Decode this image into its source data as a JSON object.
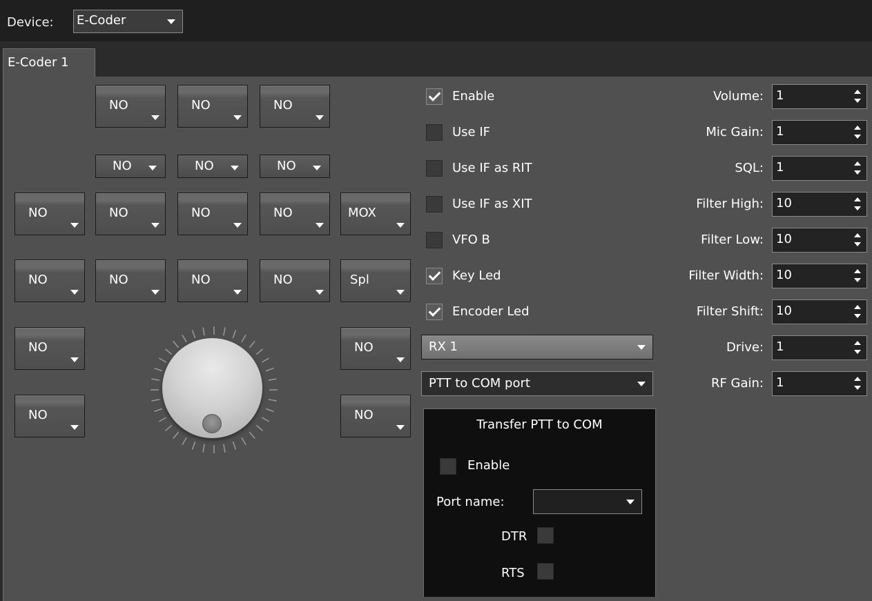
{
  "toolbar": {
    "device_label": "Device:",
    "device_value": "E-Coder"
  },
  "tabs": [
    {
      "label": "E-Coder 1"
    }
  ],
  "buttons": {
    "top_row": [
      "NO",
      "NO",
      "NO"
    ],
    "small_row": [
      "NO",
      "NO",
      "NO"
    ],
    "row1": [
      "NO",
      "NO",
      "NO",
      "NO",
      "MOX"
    ],
    "row2": [
      "NO",
      "NO",
      "NO",
      "NO",
      "Spl"
    ],
    "left_lower": [
      "NO",
      "NO"
    ],
    "right_lower": [
      "NO",
      "NO"
    ]
  },
  "checkboxes": [
    {
      "label": "Enable",
      "checked": true
    },
    {
      "label": "Use IF",
      "checked": false
    },
    {
      "label": "Use IF as RIT",
      "checked": false
    },
    {
      "label": "Use IF as XIT",
      "checked": false
    },
    {
      "label": "VFO B",
      "checked": false
    },
    {
      "label": "Key Led",
      "checked": true
    },
    {
      "label": "Encoder Led",
      "checked": true
    }
  ],
  "rx_select": "RX 1",
  "ptt_select": "PTT to COM port",
  "ptt_box": {
    "title": "Transfer PTT to COM",
    "enable_label": "Enable",
    "port_label": "Port name:",
    "port_value": "",
    "dtr_label": "DTR",
    "rts_label": "RTS"
  },
  "spinners": [
    {
      "label": "Volume:",
      "value": "1"
    },
    {
      "label": "Mic Gain:",
      "value": "1"
    },
    {
      "label": "SQL:",
      "value": "1"
    },
    {
      "label": "Filter High:",
      "value": "10"
    },
    {
      "label": "Filter Low:",
      "value": "10"
    },
    {
      "label": "Filter Width:",
      "value": "10"
    },
    {
      "label": "Filter Shift:",
      "value": "10"
    },
    {
      "label": "Drive:",
      "value": "1"
    },
    {
      "label": "RF Gain:",
      "value": "1"
    }
  ],
  "colors": {
    "background": "#2b2b2b",
    "panel": "#505050",
    "ptt_box": "#0f0f0f"
  },
  "icons": [
    "dropdown-arrow-icon",
    "spin-up-icon",
    "spin-down-icon",
    "checkmark-icon"
  ]
}
